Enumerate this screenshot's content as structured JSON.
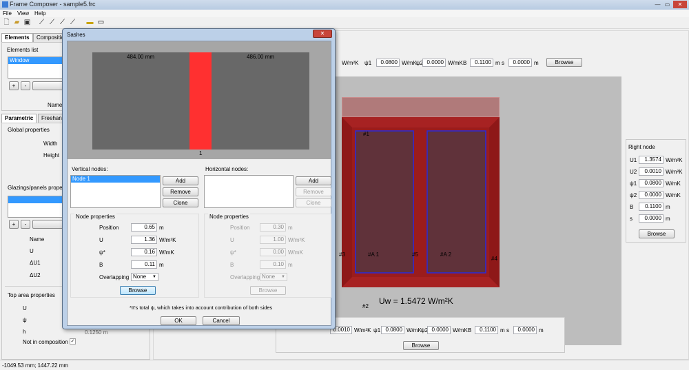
{
  "app": {
    "title": "Frame Composer - sample5.frc"
  },
  "menu": [
    "File",
    "View",
    "Help"
  ],
  "left": {
    "tabs": [
      "Elements",
      "Composition"
    ],
    "elements_list_label": "Elements list",
    "elements": [
      "Window"
    ],
    "add": "+",
    "remove": "-",
    "name_label": "Name",
    "sub_tabs": [
      "Parametric",
      "Freehand"
    ],
    "global_props": "Global properties",
    "width_label": "Width",
    "height_label": "Height",
    "glazings_label": "Glazings/panels properties",
    "gp_name": "Name",
    "gp_u": "U",
    "gp_du1": "ΔU1",
    "gp_du2": "ΔU2",
    "top_area": "Top area properties",
    "ta_u": "U",
    "ta_psi": "ψ",
    "ta_h": "h",
    "ta_h_value": "0.1250 m",
    "not_in_comp": "Not in composition",
    "check": "✓"
  },
  "main": {
    "top_row": {
      "u2_unit": "W/m²K",
      "psi1_label": "ψ1",
      "psi1": "0.0800",
      "psi1_unit": "W/mK",
      "psi2_label": "ψ2",
      "psi2": "0.0000",
      "psi2_unit": "W/mK",
      "b_label": "B",
      "b": "0.1100",
      "b_unit": "m",
      "s_label": "s",
      "s": "0.0000",
      "s_unit": "m",
      "browse": "Browse"
    },
    "bottom_row": {
      "u2": "0.0010",
      "u2_unit": "W/m²K",
      "psi1_label": "ψ1",
      "psi1": "0.0800",
      "psi1_unit": "W/mK",
      "psi2_label": "ψ2",
      "psi2": "0.0000",
      "psi2_unit": "W/mK",
      "b_label": "B",
      "b": "0.1100",
      "b_unit": "m",
      "s_label": "s",
      "s": "0.0000",
      "s_unit": "m",
      "browse": "Browse"
    },
    "drawing": {
      "labels": {
        "n1": "#1",
        "n2": "#2",
        "n3": "#3",
        "n4": "#4",
        "n5": "#5",
        "a1": "#A 1",
        "a2": "#A 2"
      },
      "uw": "Uw = 1.5472 W/m²K"
    },
    "right_node": {
      "title": "Right node",
      "rows": [
        {
          "label": "U1",
          "value": "1.3574",
          "unit": "W/m²K"
        },
        {
          "label": "U2",
          "value": "0.0010",
          "unit": "W/m²K"
        },
        {
          "label": "ψ1",
          "value": "0.0800",
          "unit": "W/mK"
        },
        {
          "label": "ψ2",
          "value": "0.0000",
          "unit": "W/mK"
        },
        {
          "label": "B",
          "value": "0.1100",
          "unit": "m"
        },
        {
          "label": "s",
          "value": "0.0000",
          "unit": "m"
        }
      ],
      "browse": "Browse"
    }
  },
  "status": "-1049.53 mm; 1447.22 mm",
  "dialog": {
    "title": "Sashes",
    "close": "✕",
    "preview": {
      "left_dim": "484.00 mm",
      "right_dim": "486.00 mm",
      "node_label": "1"
    },
    "vertical_nodes_label": "Vertical nodes:",
    "vertical_nodes": [
      "Node 1"
    ],
    "horizontal_nodes_label": "Horizontal nodes:",
    "add": "Add",
    "remove": "Remove",
    "clone": "Clone",
    "node_props_label": "Node properties",
    "v_props": {
      "position_label": "Position",
      "position": "0.65",
      "position_unit": "m",
      "u_label": "U",
      "u": "1.36",
      "u_unit": "W/m²K",
      "psi_label": "ψ*",
      "psi": "0.16",
      "psi_unit": "W/mK",
      "b_label": "B",
      "b": "0.11",
      "b_unit": "m",
      "overlap_label": "Overlapping",
      "overlap": "None",
      "browse": "Browse"
    },
    "h_props": {
      "position_label": "Position",
      "position": "0.30",
      "position_unit": "m",
      "u_label": "U",
      "u": "1.00",
      "u_unit": "W/m²K",
      "psi_label": "ψ*",
      "psi": "0.00",
      "psi_unit": "W/mK",
      "b_label": "B",
      "b": "0.10",
      "b_unit": "m",
      "overlap_label": "Overlapping",
      "overlap": "None",
      "browse": "Browse"
    },
    "footnote": "*It's total ψ, which takes into account contribution of both sides",
    "ok": "OK",
    "cancel": "Cancel"
  }
}
